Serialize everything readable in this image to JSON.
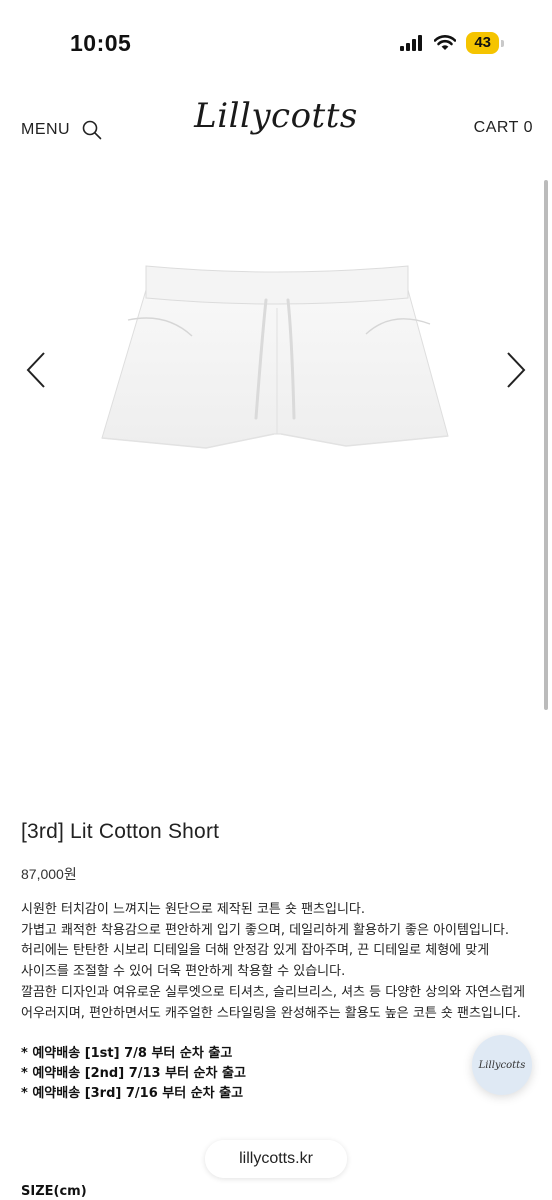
{
  "status_bar": {
    "time": "10:05",
    "battery": "43",
    "battery_color": "#f5c400"
  },
  "header": {
    "menu_label": "MENU",
    "logo": "Lillycotts",
    "cart_label": "CART 0"
  },
  "product": {
    "title": "[3rd] Lit Cotton Short",
    "price": "87,000원",
    "description": [
      "시원한 터치감이 느껴지는 원단으로 제작된 코튼 숏 팬츠입니다.",
      "가볍고 쾌적한 착용감으로 편안하게 입기 좋으며, 데일리하게 활용하기 좋은 아이템입니다.",
      "허리에는 탄탄한 시보리 디테일을 더해 안정감 있게 잡아주며, 끈 디테일로 체형에 맞게 사이즈를 조절할 수 있어 더욱 편안하게 착용할 수 있습니다.",
      "깔끔한 디자인과 여유로운 실루엣으로 티셔츠, 슬리브리스, 셔츠 등 다양한 상의와 자연스럽게 어우러지며, 편안하면서도 캐주얼한 스타일링을 완성해주는 활용도 높은 코튼 숏 팬츠입니다."
    ],
    "notices": [
      "* 예약배송 [1st] 7/8 부터 순차 출고",
      "* 예약배송 [2nd] 7/13 부터 순차 출고",
      "* 예약배송 [3rd] 7/16 부터 순차 출고"
    ],
    "size_heading": "SIZE(cm)"
  },
  "chat_bubble": {
    "label": "Lillycotts"
  },
  "browser": {
    "url": "lillycotts.kr"
  },
  "icons": [
    "signal-icon",
    "wifi-icon",
    "battery-icon",
    "search-icon",
    "chevron-left-icon",
    "chevron-right-icon"
  ]
}
